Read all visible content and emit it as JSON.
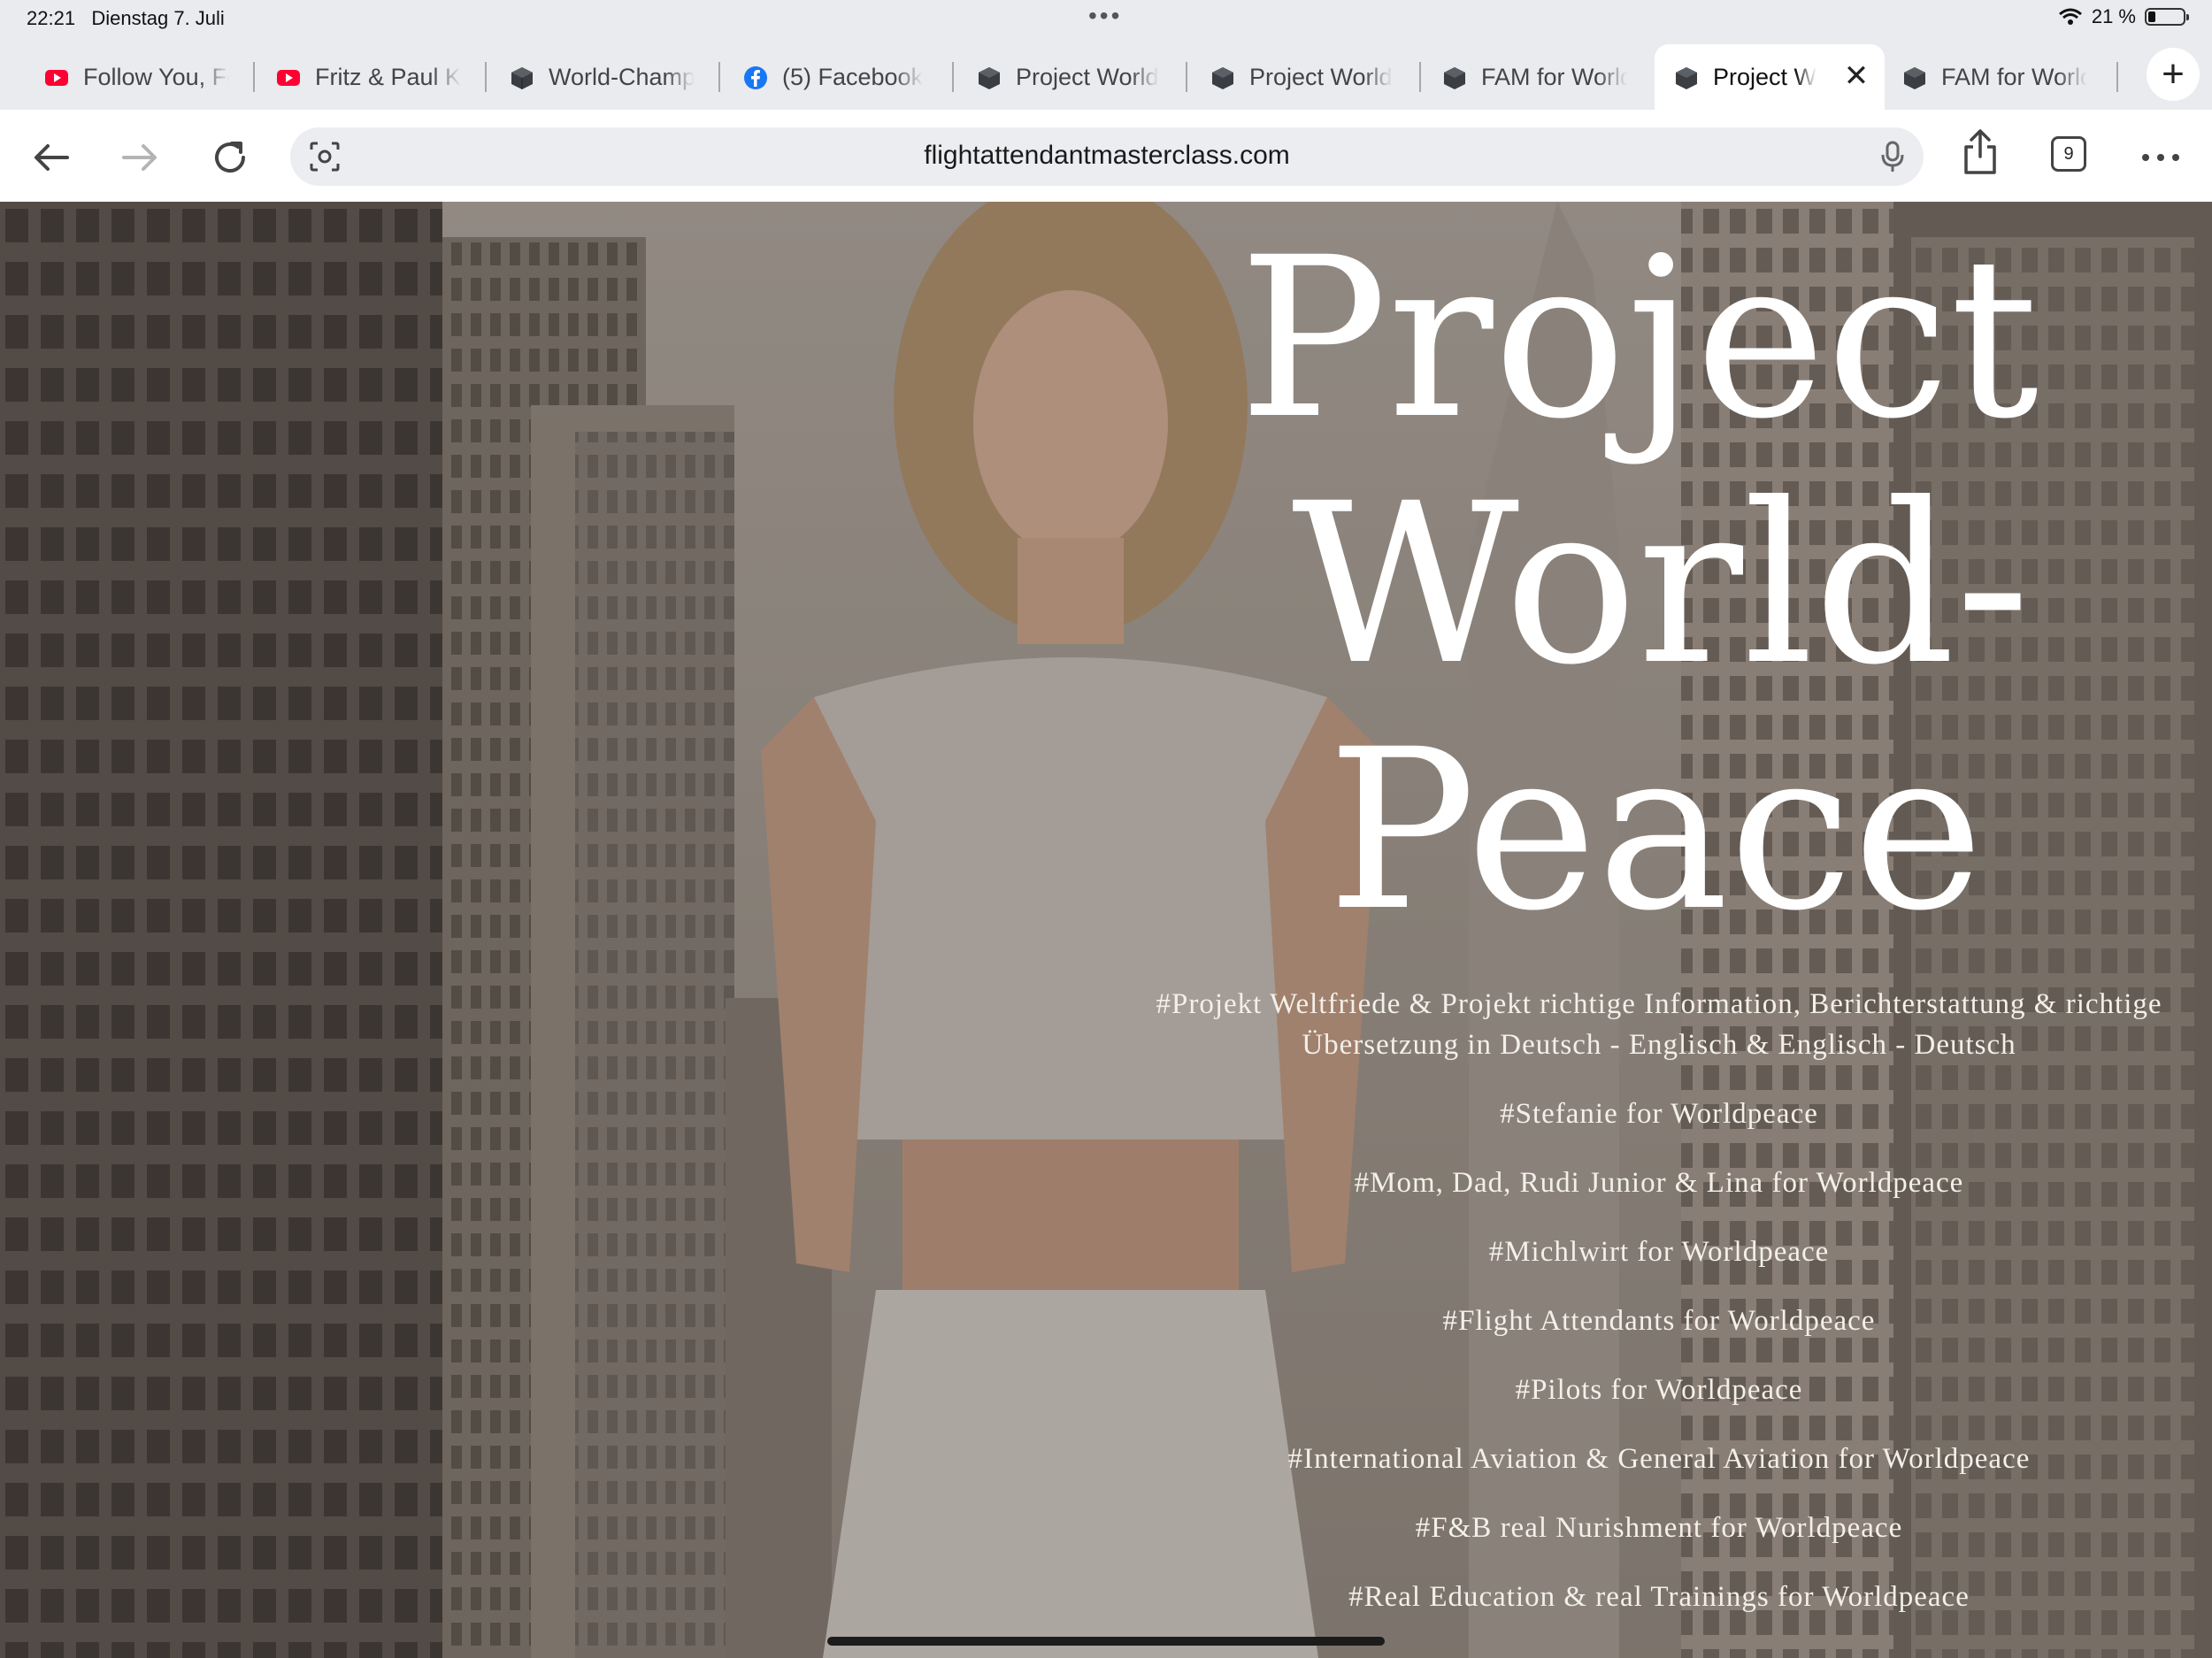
{
  "status_bar": {
    "time": "22:21",
    "date": "Dienstag 7. Juli",
    "battery": "21 %",
    "battery_level": 0.21
  },
  "tabs": [
    {
      "label": "Follow You, Fo",
      "icon": "youtube-icon",
      "active": false
    },
    {
      "label": "Fritz & Paul Ka",
      "icon": "youtube-icon",
      "active": false
    },
    {
      "label": "World-Champ",
      "icon": "cube-icon",
      "active": false
    },
    {
      "label": "(5) Facebook",
      "icon": "facebook-icon",
      "active": false
    },
    {
      "label": "Project World",
      "icon": "cube-icon",
      "active": false
    },
    {
      "label": "Project World",
      "icon": "cube-icon",
      "active": false
    },
    {
      "label": "FAM for World",
      "icon": "cube-icon",
      "active": false
    },
    {
      "label": "Project W",
      "icon": "cube-icon",
      "active": true
    },
    {
      "label": "FAM for World",
      "icon": "cube-icon",
      "active": false
    }
  ],
  "toolbar": {
    "url": "flightattendantmasterclass.com",
    "tab_count": "9"
  },
  "hero": {
    "title_lines": [
      "Project",
      "World-",
      "Peace"
    ],
    "hashtags": [
      "#Projekt Weltfriede & Projekt richtige Information, Berichterstattung & richtige Übersetzung in Deutsch - Englisch & Englisch - Deutsch",
      "#Stefanie for Worldpeace",
      "#Mom, Dad, Rudi Junior & Lina for Worldpeace",
      "#Michlwirt for Worldpeace",
      "#Flight Attendants for Worldpeace",
      "#Pilots for Worldpeace",
      "#International Aviation & General Aviation for Worldpeace",
      "#F&B real Nurishment for Worldpeace",
      "#Real Education & real Trainings for Worldpeace"
    ]
  },
  "colors": {
    "youtube_red": "#ff0033",
    "facebook_blue": "#1877f2",
    "title_white": "#ffffff"
  }
}
